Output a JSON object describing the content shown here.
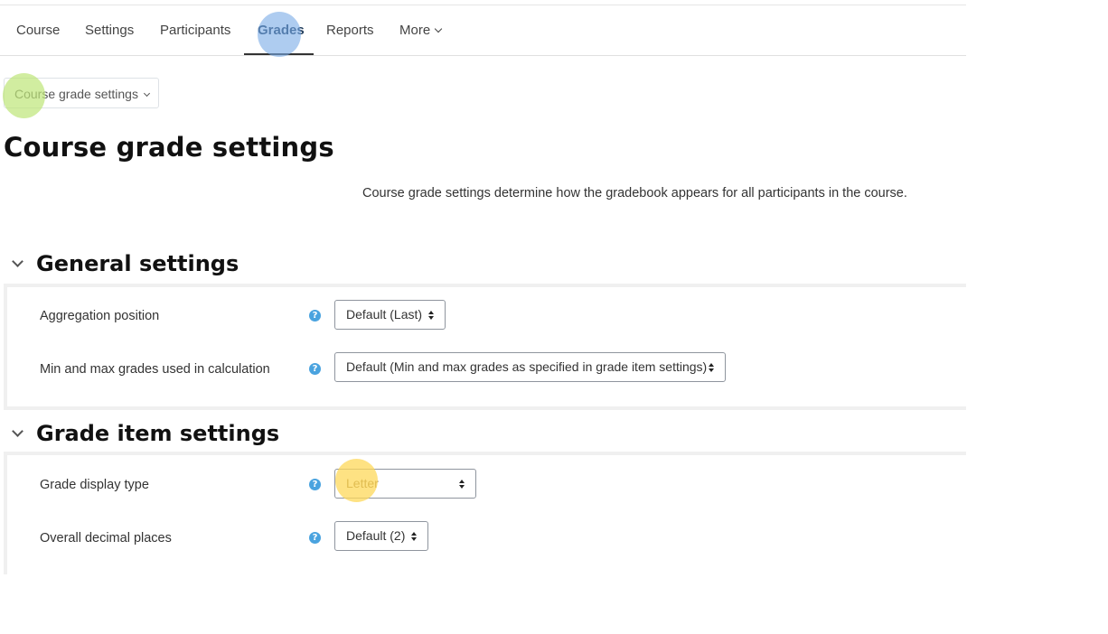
{
  "nav": {
    "items": [
      {
        "label": "Course"
      },
      {
        "label": "Settings"
      },
      {
        "label": "Participants"
      },
      {
        "label": "Grades"
      },
      {
        "label": "Reports"
      },
      {
        "label": "More"
      }
    ],
    "active_index": 3
  },
  "dropdown": {
    "label": "Course grade settings",
    "icon": "chevron-down-icon"
  },
  "page": {
    "title": "Course grade settings",
    "description": "Course grade settings determine how the gradebook appears for all participants in the course."
  },
  "sections": [
    {
      "title": "General settings",
      "fields": [
        {
          "label": "Aggregation position",
          "value": "Default (Last)"
        },
        {
          "label": "Min and max grades used in calculation",
          "value": "Default (Min and max grades as specified in grade item settings)"
        }
      ]
    },
    {
      "title": "Grade item settings",
      "fields": [
        {
          "label": "Grade display type",
          "value": "Letter"
        },
        {
          "label": "Overall decimal places",
          "value": "Default (2)"
        }
      ]
    }
  ],
  "help_icon_glyph": "?",
  "colors": {
    "help_icon": "#4aa3df",
    "active_nav": "#1f3b5a",
    "highlight_blue": "#78aae6",
    "highlight_green": "#bee678",
    "highlight_yellow": "#fdd85a"
  }
}
